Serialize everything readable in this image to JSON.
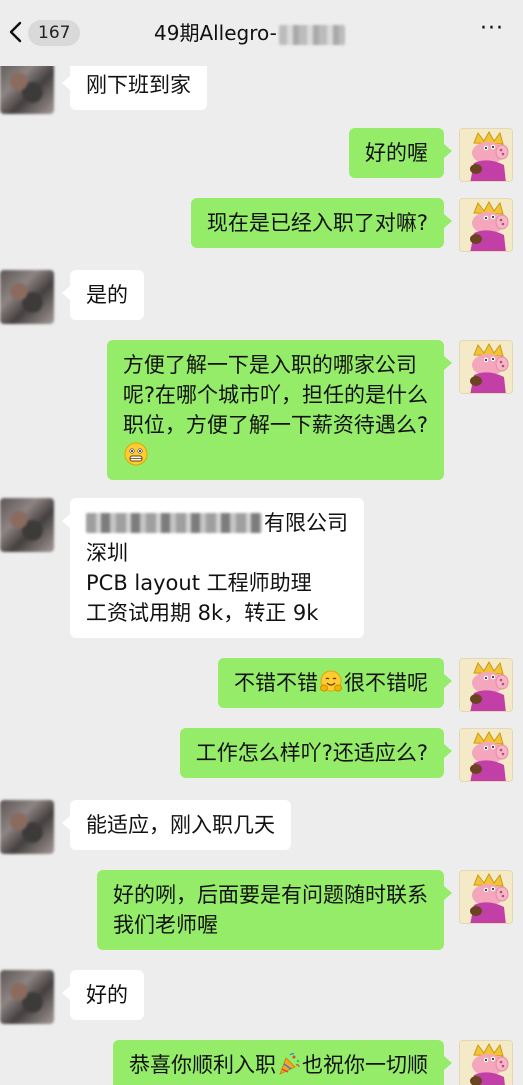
{
  "header": {
    "unread_count": "167",
    "title": "49期Allegro-"
  },
  "messages": [
    {
      "side": "in",
      "lines": [
        "刚下班到家"
      ]
    },
    {
      "side": "out",
      "lines": [
        "好的喔"
      ]
    },
    {
      "side": "out",
      "lines": [
        "现在是已经入职了对嘛?"
      ]
    },
    {
      "side": "in",
      "lines": [
        "是的"
      ]
    },
    {
      "side": "out",
      "lines": [
        "方便了解一下是入职的哪家公司",
        "呢?在哪个城市吖，担任的是什么",
        "职位，方便了解一下薪资待遇么?"
      ],
      "trailing_emoji": "grimace-emoji"
    },
    {
      "side": "in",
      "lines": [
        "有限公司",
        "深圳",
        "PCB layout 工程师助理",
        "工资试用期 8k，转正 9k"
      ]
    },
    {
      "side": "out",
      "parts": [
        "不错不错",
        "很不错呢"
      ],
      "emoji": "hugging-emoji"
    },
    {
      "side": "out",
      "lines": [
        "工作怎么样吖?还适应么?"
      ]
    },
    {
      "side": "in",
      "lines": [
        "能适应，刚入职几天"
      ]
    },
    {
      "side": "out",
      "lines": [
        "好的咧，后面要是有问题随时联系",
        "我们老师喔"
      ]
    },
    {
      "side": "in",
      "lines": [
        "好的"
      ]
    },
    {
      "side": "out",
      "parts": [
        "恭喜你顺利入职",
        "也祝你一切顺"
      ],
      "emoji": "party-popper-emoji"
    }
  ],
  "colors": {
    "background": "#ededed",
    "incoming_bubble": "#ffffff",
    "outgoing_bubble": "#95ec69"
  }
}
